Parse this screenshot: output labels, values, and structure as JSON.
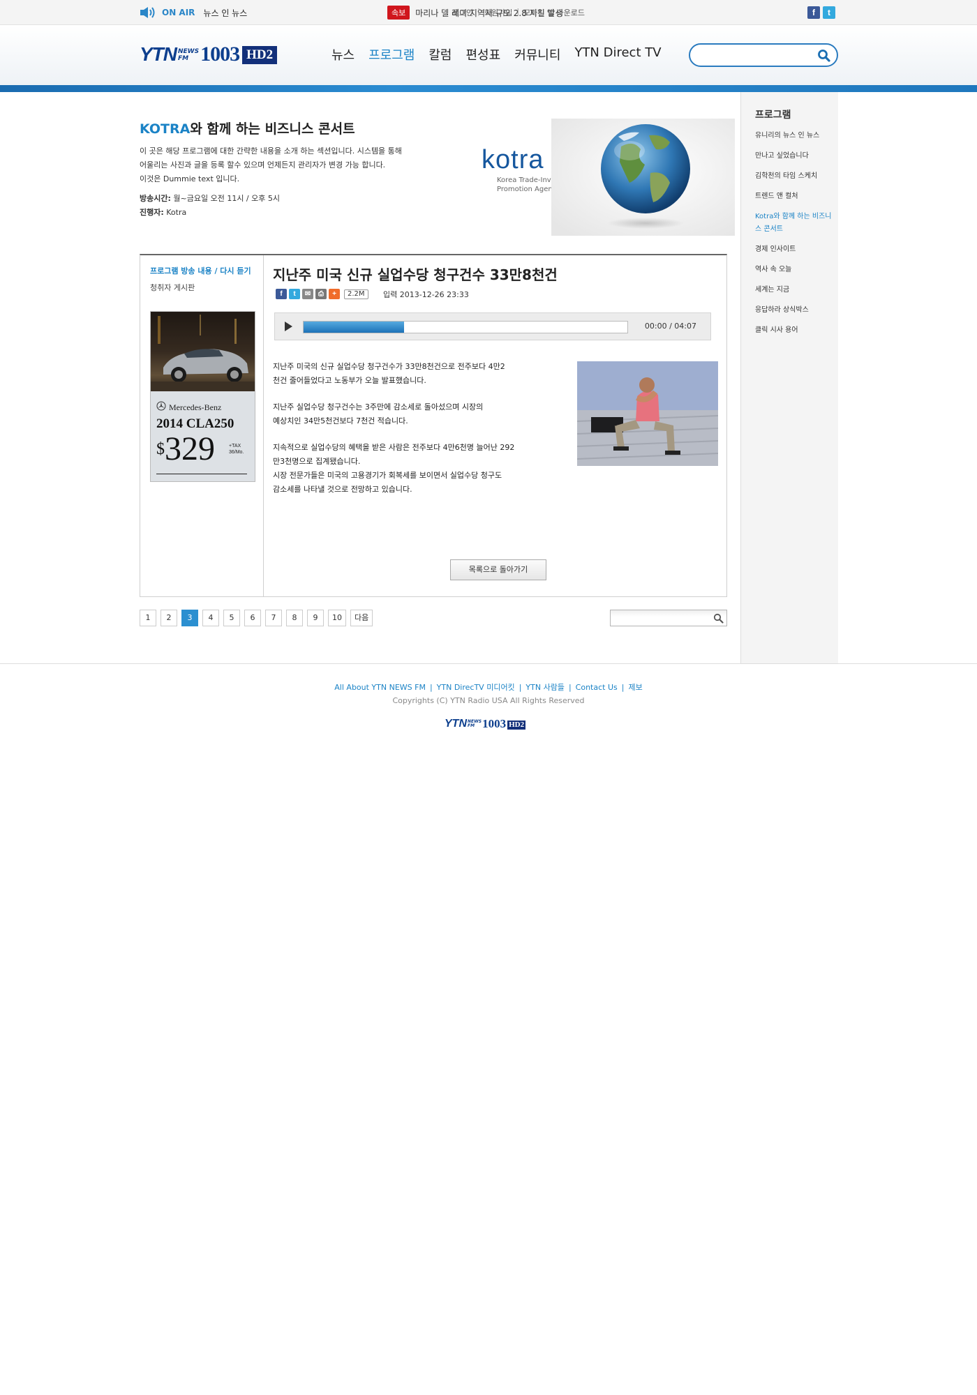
{
  "topbar": {
    "onair_label": "ON AIR",
    "onair_program": "뉴스 인 뉴스",
    "breaking_badge": "속보",
    "breaking_text": "마리나 델 레이 지역서 규모 2.8 지진 발생",
    "links": [
      "로그인",
      "회원가입",
      "모바일 앱 다운로드"
    ],
    "sns": [
      {
        "name": "facebook-icon",
        "glyph": "f",
        "color": "#3b5998"
      },
      {
        "name": "twitter-icon",
        "glyph": "t",
        "color": "#33a9de"
      }
    ]
  },
  "header": {
    "logo": {
      "ytn": "YTN",
      "news": "NEWS",
      "fm": "FM",
      "freq": "1003",
      "hd2": "HD2"
    },
    "nav": [
      "뉴스",
      "프로그램",
      "칼럼",
      "편성표",
      "커뮤니티",
      "YTN Direct TV"
    ],
    "nav_active_index": 1,
    "search_placeholder": ""
  },
  "sidebar": {
    "title": "프로그램",
    "items": [
      "유니리의 뉴스 인 뉴스",
      "만나고 싶었습니다",
      "김학천의 타임 스케치",
      "트렌드 앤 컬처",
      "Kotra와 함께 하는 비즈니스 콘서트",
      "경제 인사이트",
      "역사 속 오늘",
      "세계는 지금",
      "응답하라 상식박스",
      "클릭 시사 용어"
    ],
    "active_index": 4
  },
  "program": {
    "title_highlight": "KOTRA",
    "title_rest": "와 함께 하는 비즈니스 콘서트",
    "desc_lines": [
      "이 곳은 해당 프로그램에 대한 간략한 내용을 소개 하는 섹션입니다. 시스템을 통해",
      "어울리는 사진과 글을 등록 할수 있으며 언제든지 관리자가 변경 가능 합니다.",
      "이것은 Dummie text 입니다."
    ],
    "time_label": "방송시간:",
    "time_value": "월~금요일 오전 11시 / 오후 5시",
    "host_label": "진행자:",
    "host_value": "Kotra",
    "banner": {
      "wordmark": "kotra",
      "sub_lines": [
        "Korea Trade-Investment",
        "Promotion Agency"
      ]
    }
  },
  "leftcol": {
    "link_replay": "프로그램 방송 내용 / 다시 듣기",
    "link_board": "청취자 게시판",
    "ad": {
      "brand": "Mercedes-Benz",
      "model": "2014 CLA250",
      "dollar": "$",
      "price": "329",
      "tax_lines": [
        "+TAX",
        "36/Mo."
      ]
    }
  },
  "article": {
    "title": "지난주 미국 신규 실업수당 청구건수 33만8천건",
    "share_count": "2.2M",
    "date": "입력 2013-12-26 23:33",
    "player": {
      "time": "00:00 / 04:07",
      "progress": 0.31
    },
    "paragraphs": [
      [
        "지난주 미국의 신규 실업수당 청구건수가 33만8천건으로 전주보다 4만2",
        "천건 줄어들었다고 노동부가 오늘 발표했습니다."
      ],
      [
        "지난주 실업수당 청구건수는 3주만에 감소세로 돌아섰으며 시장의",
        "예상치인 34만5천건보다 7천건 적습니다."
      ],
      [
        "지속적으로 실업수당의 혜택을 받은 사람은 전주보다 4만6천명 늘어난 292",
        "만3천명으로 집계됐습니다.",
        "시장 전문가들은 미국의 고용경기가 회복세를 보이면서 실업수당 청구도",
        "감소세를 나타낼 것으로 전망하고 있습니다."
      ]
    ],
    "back_label": "목록으로 돌아가기"
  },
  "pager": {
    "pages": [
      "1",
      "2",
      "3",
      "4",
      "5",
      "6",
      "7",
      "8",
      "9",
      "10"
    ],
    "current_index": 2,
    "next_label": "다음",
    "search_placeholder": ""
  },
  "footer": {
    "links": [
      "All About YTN NEWS FM",
      "YTN DirecTV 미디어킷",
      "YTN 사람들",
      "Contact Us",
      "제보"
    ],
    "copyright": "Copyrights (C) YTN Radio USA All Rights Reserved"
  }
}
